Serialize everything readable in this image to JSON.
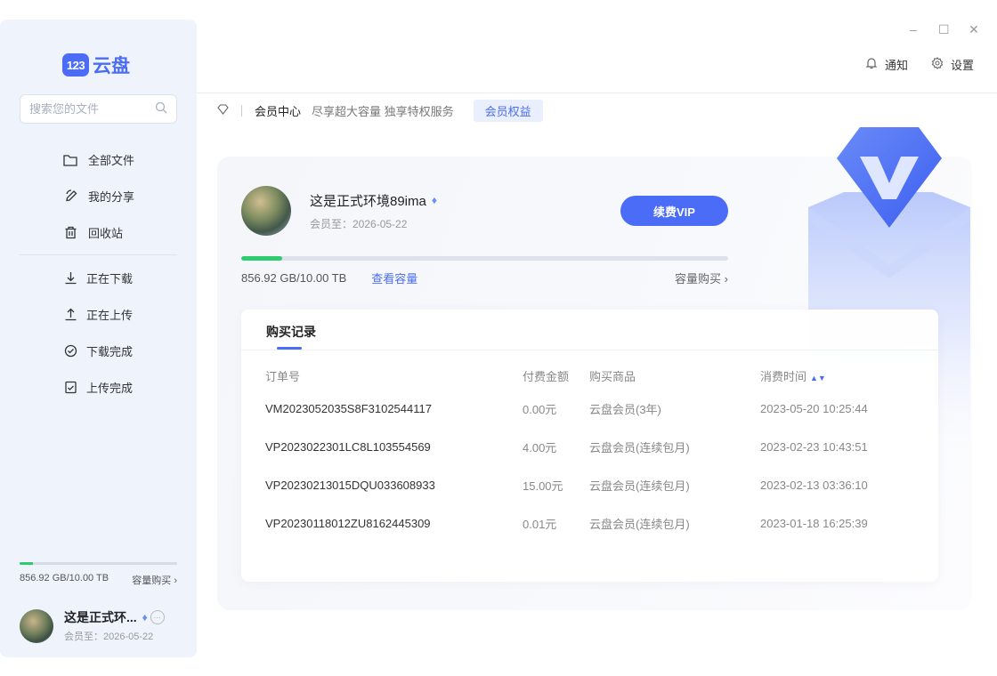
{
  "app": {
    "logo_badge": "123",
    "logo_text": "云盘"
  },
  "search": {
    "placeholder": "搜索您的文件"
  },
  "sidebar": {
    "primary": [
      {
        "label": "全部文件",
        "icon": "folder-icon"
      },
      {
        "label": "我的分享",
        "icon": "share-icon"
      },
      {
        "label": "回收站",
        "icon": "trash-icon"
      }
    ],
    "transfer": [
      {
        "label": "正在下载",
        "icon": "download-icon"
      },
      {
        "label": "正在上传",
        "icon": "upload-icon"
      },
      {
        "label": "下载完成",
        "icon": "check-circle-icon"
      },
      {
        "label": "上传完成",
        "icon": "check-file-icon"
      }
    ],
    "quota_text": "856.92 GB/10.00 TB",
    "quota_buy": "容量购买",
    "quota_fraction": 0.084,
    "user_name": "这是正式环...",
    "user_sub": "会员至：2026-05-22"
  },
  "topbar": {
    "notify": "通知",
    "settings": "设置"
  },
  "breadcrumb": {
    "title": "会员中心",
    "desc": "尽享超大容量 独享特权服务",
    "tag": "会员权益"
  },
  "profile": {
    "name": "这是正式环境89ima",
    "expire": "会员至：2026-05-22",
    "renew": "续费VIP",
    "quota_text": "856.92 GB/10.00 TB",
    "view_quota": "查看容量",
    "buy_quota": "容量购买"
  },
  "records": {
    "tab": "购买记录",
    "headers": [
      "订单号",
      "付费金额",
      "购买商品",
      "消费时间"
    ],
    "rows": [
      [
        "VM2023052035S8F3102544117",
        "0.00元",
        "云盘会员(3年)",
        "2023-05-20 10:25:44"
      ],
      [
        "VP2023022301LC8L103554569",
        "4.00元",
        "云盘会员(连续包月)",
        "2023-02-23 10:43:51"
      ],
      [
        "VP20230213015DQU033608933",
        "15.00元",
        "云盘会员(连续包月)",
        "2023-02-13 03:36:10"
      ],
      [
        "VP20230118012ZU8162445309",
        "0.01元",
        "云盘会员(连续包月)",
        "2023-01-18 16:25:39"
      ]
    ]
  },
  "colors": {
    "accent": "#4a6cf7",
    "progress": "#2ecc71",
    "sidebar_bg": "#eef3fc"
  }
}
